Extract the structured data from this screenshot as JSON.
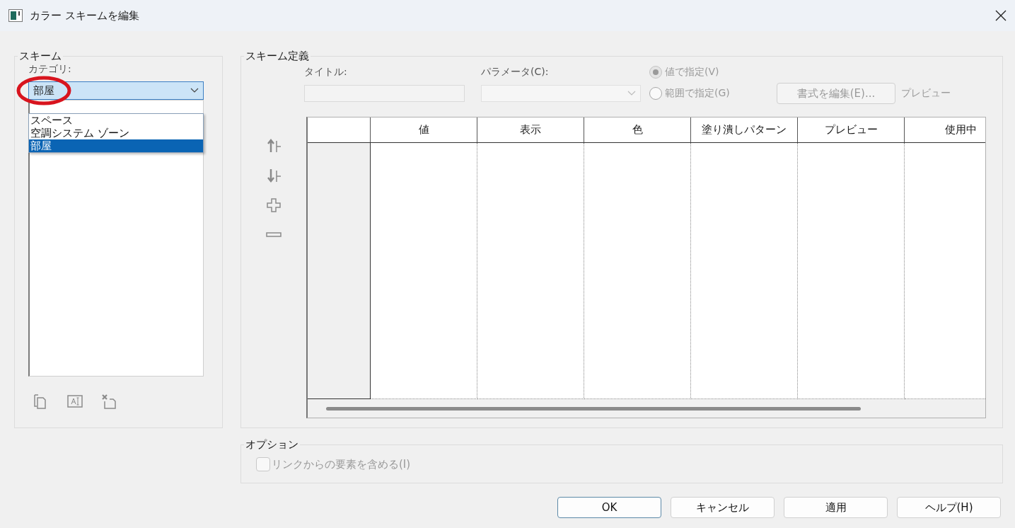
{
  "window": {
    "title": "カラー スキームを編集"
  },
  "scheme": {
    "legend": "スキーム",
    "category_label": "カテゴリ:",
    "category_value": "部屋",
    "dropdown": {
      "expanded": true,
      "options": [
        {
          "label": "スペース",
          "selected": false
        },
        {
          "label": "空調システム ゾーン",
          "selected": false
        },
        {
          "label": "部屋",
          "selected": true
        }
      ]
    }
  },
  "definition": {
    "legend": "スキーム定義",
    "title_label": "タイトル:",
    "parameter_label": "パラメータ(C):",
    "modes": [
      {
        "label": "値で指定(V)",
        "selected": true
      },
      {
        "label": "範囲で指定(G)",
        "selected": false
      }
    ],
    "edit_format_button": {
      "label": "書式を編集(E)...",
      "disabled": true
    },
    "preview_label": "プレビュー",
    "table": {
      "columns": [
        "値",
        "表示",
        "色",
        "塗り潰しパターン",
        "プレビュー",
        "使用中"
      ]
    }
  },
  "options": {
    "legend": "オプション",
    "include_links": {
      "label": "リンクからの要素を含める(I)",
      "checked": false,
      "disabled": true
    }
  },
  "buttons": [
    {
      "label": "OK",
      "default": true
    },
    {
      "label": "キャンセル",
      "default": false
    },
    {
      "label": "適用",
      "default": false
    },
    {
      "label": "ヘルプ(H)",
      "default": false
    }
  ]
}
